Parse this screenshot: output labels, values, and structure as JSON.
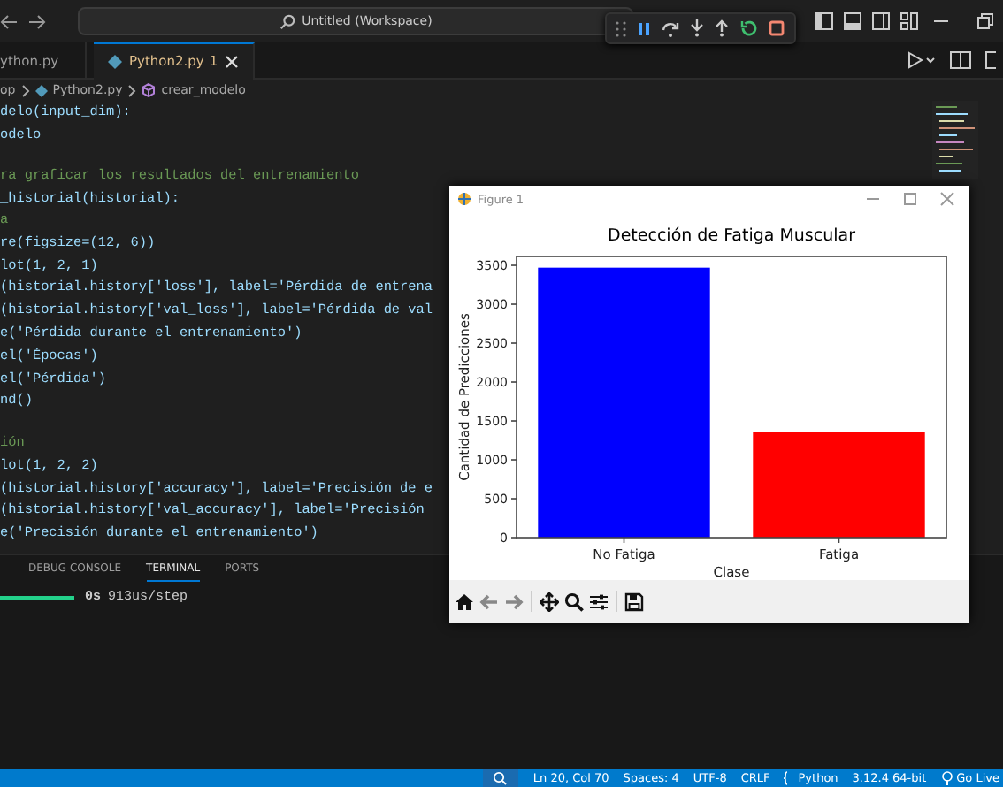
{
  "title_bar": {
    "search": "Untitled (Workspace)"
  },
  "tabs": [
    {
      "label": "ython.py",
      "selected": false
    },
    {
      "label": "Python2.py",
      "badge": "1",
      "selected": true
    }
  ],
  "breadcrumb": [
    "op",
    "Python2.py",
    "crear_modelo"
  ],
  "code_lines": [
    {
      "kind": "code",
      "text": "delo(input_dim):"
    },
    {
      "kind": "code",
      "text": "odelo"
    },
    {
      "kind": "blank"
    },
    {
      "kind": "comment",
      "text": "ra graficar los resultados del entrenamiento"
    },
    {
      "kind": "code",
      "text": "_historial(historial):"
    },
    {
      "kind": "comment",
      "text": "a"
    },
    {
      "kind": "code",
      "text": "re(figsize=(12, 6))"
    },
    {
      "kind": "code",
      "text": "lot(1, 2, 1)"
    },
    {
      "kind": "code",
      "text": "(historial.history['loss'], label='Pérdida de entrena"
    },
    {
      "kind": "code",
      "text": "(historial.history['val_loss'], label='Pérdida de val"
    },
    {
      "kind": "code",
      "text": "e('Pérdida durante el entrenamiento')"
    },
    {
      "kind": "code",
      "text": "el('Épocas')"
    },
    {
      "kind": "code",
      "text": "el('Pérdida')"
    },
    {
      "kind": "code",
      "text": "nd()"
    },
    {
      "kind": "blank"
    },
    {
      "kind": "comment",
      "text": "ión"
    },
    {
      "kind": "code",
      "text": "lot(1, 2, 2)"
    },
    {
      "kind": "code",
      "text": "(historial.history['accuracy'], label='Precisión de e"
    },
    {
      "kind": "code",
      "text": "(historial.history['val_accuracy'], label='Precisión"
    },
    {
      "kind": "code",
      "text": "e('Precisión durante el entrenamiento')"
    }
  ],
  "panel_tabs": [
    {
      "label": "DEBUG CONSOLE",
      "selected": false
    },
    {
      "label": "TERMINAL",
      "selected": true
    },
    {
      "label": "PORTS",
      "selected": false
    }
  ],
  "terminal": {
    "time": "0s",
    "rate": "913us/step"
  },
  "status_bar": [
    {
      "kind": "position",
      "text": "Ln 20, Col 70"
    },
    {
      "kind": "plain",
      "text": "Spaces: 4"
    },
    {
      "kind": "plain",
      "text": "UTF-8"
    },
    {
      "kind": "plain",
      "text": "CRLF"
    },
    {
      "kind": "language",
      "text": "Python"
    },
    {
      "kind": "plain",
      "text": "3.12.4 64-bit"
    },
    {
      "kind": "live",
      "text": "Go Live"
    }
  ],
  "figure": {
    "title": "Figure 1",
    "chart_data": {
      "type": "bar",
      "title": "Detección de Fatiga Muscular",
      "xlabel": "Clase",
      "ylabel": "Cantidad de Predicciones",
      "stacked": true,
      "series": [
        {
          "name": "No Fatiga",
          "color": "#0000ff",
          "values": [
            3470,
            null
          ]
        },
        {
          "name": "Fatiga",
          "color": "#ff0000",
          "values": [
            null,
            1360
          ]
        }
      ],
      "ylim": [
        0,
        3614
      ],
      "yticks": [
        0,
        500,
        1000,
        1500,
        2000,
        2500,
        3000,
        3500
      ]
    }
  }
}
